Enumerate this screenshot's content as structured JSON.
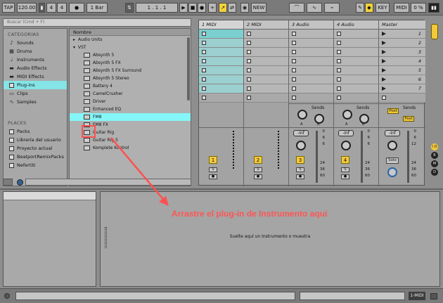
{
  "transport": {
    "tap": "TAP",
    "tempo": "120.00",
    "sig_num": "4",
    "sig_den": "4",
    "metro": "●",
    "quant": "1 Bar",
    "position": "1 . 1 . 1",
    "new": "NEW",
    "key": "KEY",
    "midi": "MIDI",
    "cpu": "0 %"
  },
  "browser": {
    "search_placeholder": "Buscar (Cmd + F)",
    "categories_title": "CATEGORÍAS",
    "categories": [
      {
        "label": "Sounds",
        "icon": "note-icon"
      },
      {
        "label": "Drums",
        "icon": "drum-icon"
      },
      {
        "label": "Instruments",
        "icon": "instrument-icon"
      },
      {
        "label": "Audio Effects",
        "icon": "audio-effect-icon"
      },
      {
        "label": "MIDI Effects",
        "icon": "midi-effect-icon"
      },
      {
        "label": "Plug-ins",
        "icon": "plugin-icon",
        "selected": true
      },
      {
        "label": "Clips",
        "icon": "clip-icon"
      },
      {
        "label": "Samples",
        "icon": "sample-icon"
      }
    ],
    "places_title": "PLACES",
    "places": [
      {
        "label": "Packs"
      },
      {
        "label": "Librería del usuario"
      },
      {
        "label": "Proyecto actual"
      },
      {
        "label": "BeatportRemixPacks"
      },
      {
        "label": "Nefertiti"
      }
    ],
    "list_header": "Nombre",
    "folders": [
      "Audio Units",
      "VST"
    ],
    "items": [
      {
        "label": "Absynth 5"
      },
      {
        "label": "Absynth 5 FX"
      },
      {
        "label": "Absynth 5 FX Surround"
      },
      {
        "label": "Absynth 5 Stereo"
      },
      {
        "label": "Battery 4"
      },
      {
        "label": "CamelCrusher"
      },
      {
        "label": "Driver"
      },
      {
        "label": "Enhanced EQ"
      },
      {
        "label": "FM8",
        "selected": true
      },
      {
        "label": "FM8 FX"
      },
      {
        "label": "Guitar Rig"
      },
      {
        "label": "Guitar Rig 5"
      },
      {
        "label": "Komplete Kontrol"
      }
    ]
  },
  "session": {
    "tracks": [
      {
        "name": "1 MIDI",
        "num": "1",
        "type": "midi"
      },
      {
        "name": "2 MIDI",
        "num": "2",
        "type": "midi"
      },
      {
        "name": "3 Audio",
        "num": "3",
        "type": "audio"
      },
      {
        "name": "4 Audio",
        "num": "4",
        "type": "audio"
      }
    ],
    "master": {
      "name": "Master",
      "scenes": [
        "1",
        "2",
        "3",
        "4",
        "5",
        "6",
        "7"
      ]
    },
    "sends_label": "Sends",
    "knob_a": "A",
    "knob_b": "B",
    "inf": "-Inf",
    "solo_s": "S",
    "post": "Post",
    "solo": "Solo",
    "scale": [
      "6",
      "12",
      "24",
      "36",
      "60"
    ],
    "scale_top": [
      "0",
      "6",
      "6"
    ]
  },
  "right_strip": {
    "io": "I O",
    "r": "R",
    "m": "M",
    "d": "D"
  },
  "device": {
    "drop_text": "Suelte aquí un Instrumento o muestra"
  },
  "annotation": {
    "text": "Arrastre el plug-in de Instrumento aquí",
    "color": "#ff5050"
  },
  "status": {
    "track_label": "1-MIDI"
  }
}
